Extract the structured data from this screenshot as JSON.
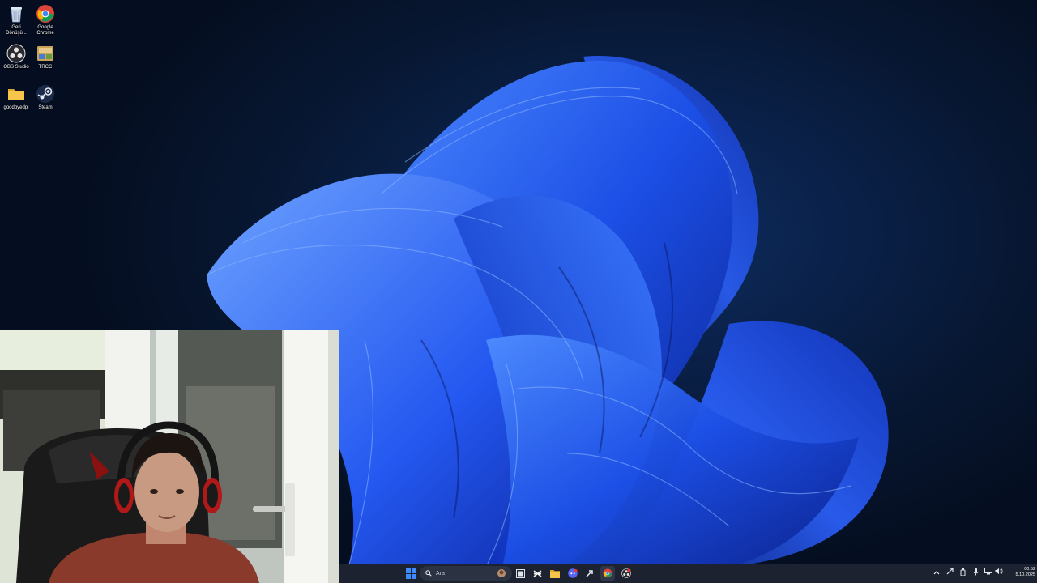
{
  "desktop": {
    "icons": [
      {
        "label_line1": "Geri",
        "label_line2": "Dönüşü...",
        "icon": "recycle-bin-icon"
      },
      {
        "label_line1": "Google",
        "label_line2": "Chrome",
        "icon": "chrome-icon"
      },
      {
        "label_line1": "OBS Studio",
        "label_line2": "",
        "icon": "obs-icon"
      },
      {
        "label_line1": "TRCC",
        "label_line2": "",
        "icon": "trcc-icon"
      },
      {
        "label_line1": "goodbyedpi",
        "label_line2": "",
        "icon": "folder-icon"
      },
      {
        "label_line1": "Steam",
        "label_line2": "",
        "icon": "steam-icon"
      }
    ]
  },
  "taskbar": {
    "search_placeholder": "Ara",
    "apps": [
      "start-icon",
      "search-icon",
      "task-view-icon",
      "capcut-icon",
      "file-explorer-icon",
      "discord-icon",
      "steam-icon",
      "chrome-icon",
      "obs-icon"
    ],
    "tray": [
      "chevron-up-icon",
      "tray-app-icon",
      "usb-icon",
      "microphone-icon",
      "network-icon",
      "volume-icon"
    ],
    "clock_time": "00:52",
    "clock_date": "5.10.2025"
  },
  "colors": {
    "accent": "#1e5bff",
    "taskbar_bg": "#1c2230",
    "background": "#071630"
  }
}
